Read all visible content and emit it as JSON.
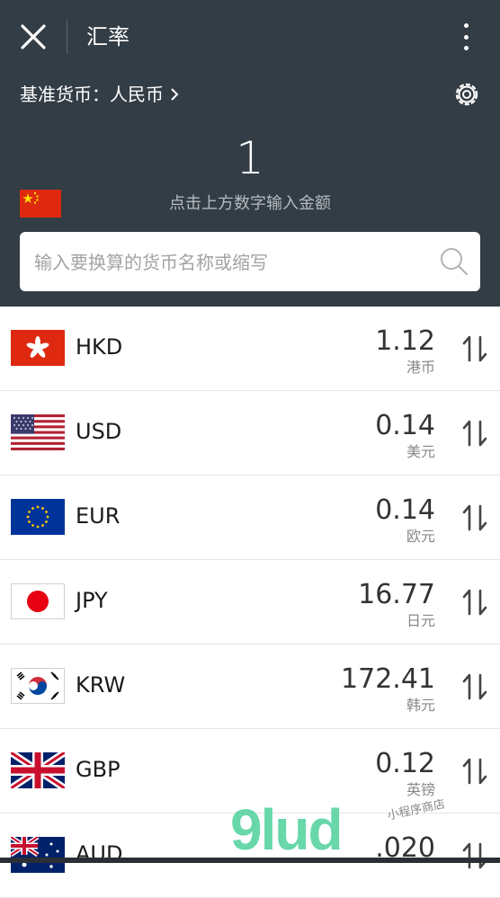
{
  "header": {
    "title": "汇率"
  },
  "base": {
    "label": "基准货币：人民币"
  },
  "amount": "1",
  "hint": "点击上方数字输入金额",
  "search": {
    "placeholder": "输入要换算的货币名称或缩写"
  },
  "rates": [
    {
      "code": "HKD",
      "value": "1.12",
      "name": "港币",
      "flag": "hk"
    },
    {
      "code": "USD",
      "value": "0.14",
      "name": "美元",
      "flag": "us"
    },
    {
      "code": "EUR",
      "value": "0.14",
      "name": "欧元",
      "flag": "eu"
    },
    {
      "code": "JPY",
      "value": "16.77",
      "name": "日元",
      "flag": "jp"
    },
    {
      "code": "KRW",
      "value": "172.41",
      "name": "韩元",
      "flag": "kr"
    },
    {
      "code": "GBP",
      "value": "0.12",
      "name": "英镑",
      "flag": "gb"
    },
    {
      "code": "AUD",
      "value": ".020",
      "name": "",
      "flag": "au"
    }
  ],
  "watermark": {
    "logo": "9lud",
    "tag": "小程序商店"
  },
  "colors": {
    "header_bg": "#333d45",
    "flag_cn": "#de2910",
    "accent_green": "#58d3a1"
  }
}
